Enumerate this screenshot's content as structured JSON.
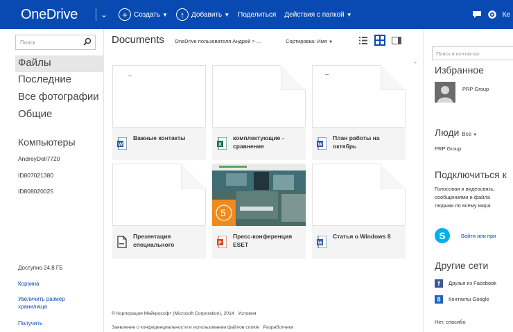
{
  "app": {
    "title": "OneDrive",
    "colors": {
      "brand": "#094ab2",
      "word": "#2b579a",
      "excel": "#217346",
      "powerpoint": "#d24726",
      "skype": "#00aff0",
      "facebook": "#3b5998",
      "google": "#1a62c4"
    }
  },
  "toolbar": {
    "create": "Создать",
    "add": "Добавить",
    "share": "Поделиться",
    "folder_actions": "Действия с папкой",
    "right_truncated": "Ке"
  },
  "leftnav": {
    "search_placeholder": "Поиск",
    "items": [
      "Файлы",
      "Последние",
      "Все фотографии",
      "Общие"
    ],
    "computers_title": "Компьютеры",
    "computers": [
      "AndreyDell7720",
      "ID807021380",
      "ID808020025"
    ],
    "storage_available": "Доступно 24,8 ГБ",
    "recycle_bin": "Корзина",
    "increase_storage": "Увеличить размер хранилища",
    "get": "Получить"
  },
  "main": {
    "title": "Documents",
    "breadcrumb": "OneDrive пользователя Андрей > ...",
    "sort": "Сортировка: Имя",
    "files": [
      {
        "name": "Важные контакты",
        "type": "word"
      },
      {
        "name": "комплектующие - сравнение",
        "type": "excel"
      },
      {
        "name": "План работы на октябрь",
        "type": "word"
      },
      {
        "name": "Презентация специального",
        "type": "doc"
      },
      {
        "name": "Пресс-конференция ESET",
        "type": "powerpoint"
      },
      {
        "name": "Статья о Windows 8",
        "type": "word"
      }
    ],
    "footer": {
      "copyright": "© Корпорация Майкрософт (Microsoft Corporation), 2014",
      "terms": "Условия",
      "privacy": "Заявление о конфиденциальности и использовании файлов cookie",
      "developers": "Разработчики"
    }
  },
  "rightpane": {
    "search_placeholder": "Поиск в контактах",
    "favorites_title": "Избранное",
    "favorite_contact": "PRP Group",
    "people_title": "Люди",
    "people_filter": "Все",
    "people_contact": "PRP Group",
    "connect_title": "Подключиться к",
    "connect_text": [
      "Голосовая и видеосвязь,",
      "сообщениями и файла",
      "людьми по всему мира"
    ],
    "skype_link": "Войти или при",
    "other_networks_title": "Другие сети",
    "facebook_link": "Друзья из Facebook",
    "google_link": "Контакты Google",
    "no_thanks": "Нет, спасибо"
  }
}
